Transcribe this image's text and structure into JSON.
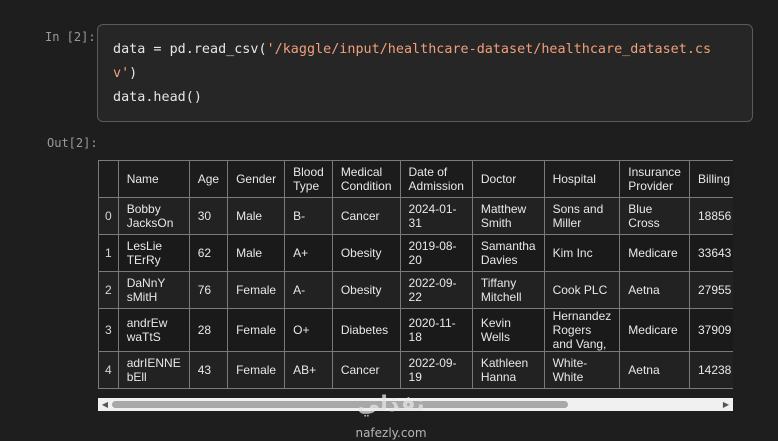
{
  "cell": {
    "in_prompt": "In [2]:",
    "out_prompt": "Out[2]:",
    "code_line1_a": "data = pd.read_csv(",
    "code_line1_str": "'/kaggle/input/healthcare-dataset/healthcare_dataset.cs",
    "code_line2_str": "v'",
    "code_line2_b": ")",
    "code_line3": "data.head()"
  },
  "table": {
    "columns": [
      "",
      "Name",
      "Age",
      "Gender",
      "Blood Type",
      "Medical Condition",
      "Date of Admission",
      "Doctor",
      "Hospital",
      "Insurance Provider",
      "Billing"
    ],
    "rows": [
      [
        "0",
        "Bobby JacksOn",
        "30",
        "Male",
        "B-",
        "Cancer",
        "2024-01-31",
        "Matthew Smith",
        "Sons and Miller",
        "Blue Cross",
        "18856"
      ],
      [
        "1",
        "LesLie TErRy",
        "62",
        "Male",
        "A+",
        "Obesity",
        "2019-08-20",
        "Samantha Davies",
        "Kim Inc",
        "Medicare",
        "33643"
      ],
      [
        "2",
        "DaNnY sMitH",
        "76",
        "Female",
        "A-",
        "Obesity",
        "2022-09-22",
        "Tiffany Mitchell",
        "Cook PLC",
        "Aetna",
        "27955"
      ],
      [
        "3",
        "andrEw waTtS",
        "28",
        "Female",
        "O+",
        "Diabetes",
        "2020-11-18",
        "Kevin Wells",
        "Hernandez Rogers and Vang,",
        "Medicare",
        "37909"
      ],
      [
        "4",
        "adrIENNE bEll",
        "43",
        "Female",
        "AB+",
        "Cancer",
        "2022-09-19",
        "Kathleen Hanna",
        "White-White",
        "Aetna",
        "14238"
      ]
    ]
  },
  "scrollbar": {
    "left_icon": "triangle-left-icon",
    "right_icon": "triangle-right-icon"
  },
  "watermark": {
    "logo_text": "نفذلي",
    "site": "nafezly.com"
  }
}
